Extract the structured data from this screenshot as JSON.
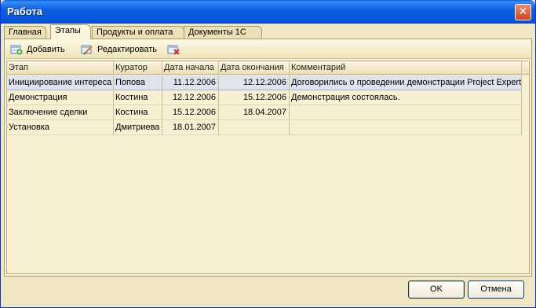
{
  "window": {
    "title": "Работа"
  },
  "tabs": [
    {
      "label": "Главная"
    },
    {
      "label": "Этапы"
    },
    {
      "label": "Продукты и оплата"
    },
    {
      "label": "Документы 1С"
    }
  ],
  "toolbar": {
    "add_label": "Добавить",
    "edit_label": "Редактировать"
  },
  "grid": {
    "columns": [
      "Этап",
      "Куратор",
      "Дата начала",
      "Дата окончания",
      "Комментарий"
    ],
    "rows": [
      {
        "stage": "Инициирование интереса",
        "curator": "Попова",
        "start": "11.12.2006",
        "end": "12.12.2006",
        "comment": "Договорились о проведении демонстрации Project Expert"
      },
      {
        "stage": "Демонстрация",
        "curator": "Костина",
        "start": "12.12.2006",
        "end": "15.12.2006",
        "comment": "Демонстрация состоялась."
      },
      {
        "stage": "Заключение сделки",
        "curator": "Костина",
        "start": "15.12.2006",
        "end": "18.04.2007",
        "comment": ""
      },
      {
        "stage": "Установка",
        "curator": "Дмитриева",
        "start": "18.01.2007",
        "end": "",
        "comment": ""
      }
    ]
  },
  "footer": {
    "ok_label": "OK",
    "cancel_label": "Отмена"
  }
}
